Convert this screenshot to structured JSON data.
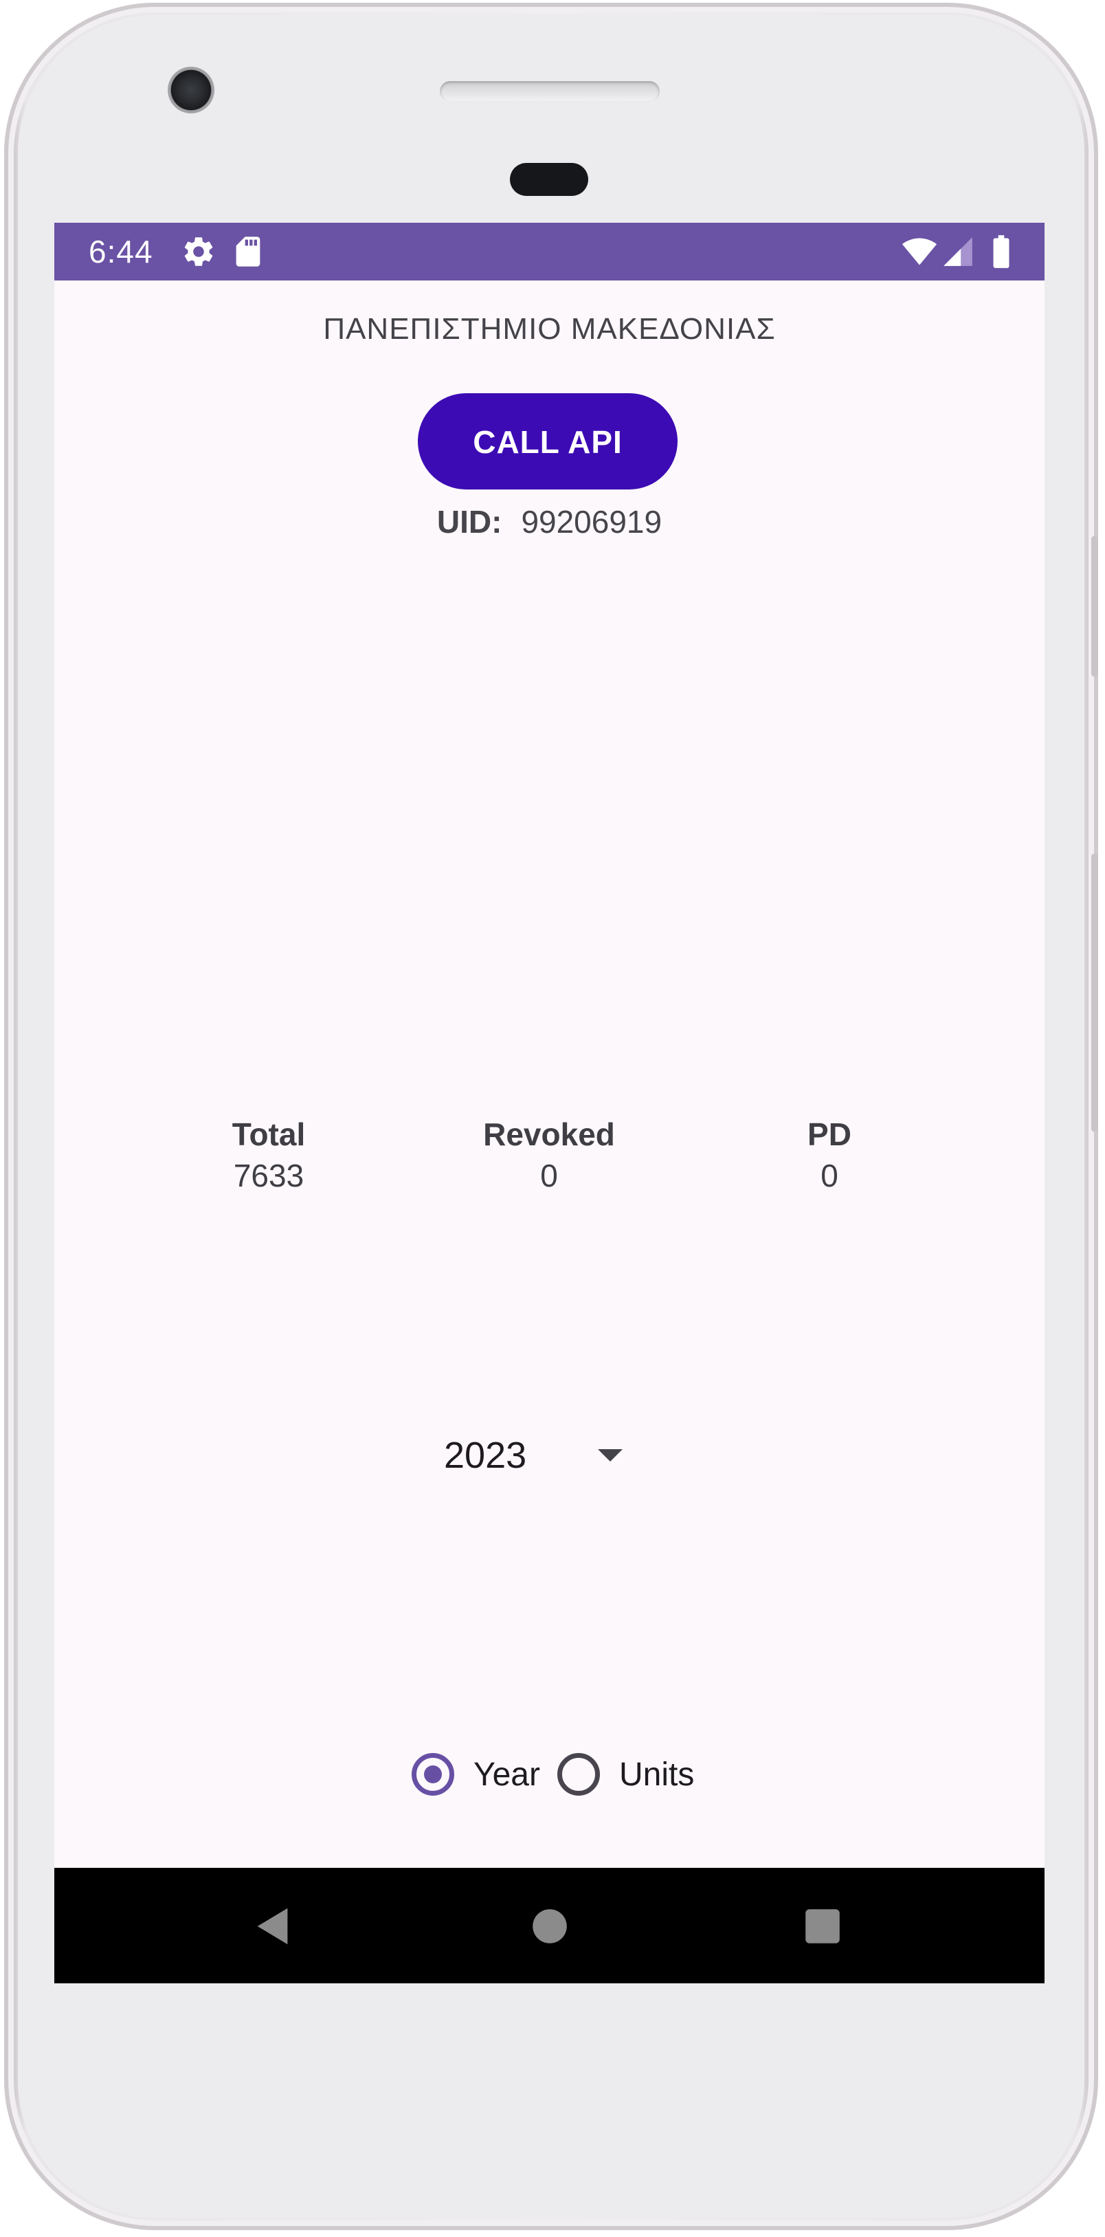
{
  "status_bar": {
    "time": "6:44",
    "icons": [
      "settings-icon",
      "sd-card-icon",
      "wifi-icon",
      "signal-icon",
      "battery-icon"
    ],
    "color": "#6a52a5"
  },
  "app": {
    "title": "ΠΑΝΕΠΙΣΤΗΜΙΟ ΜΑΚΕΔΟΝΙΑΣ",
    "call_button_label": "CALL API",
    "call_button_color": "#3d0bb4",
    "uid_label": "UID:",
    "uid_value": "99206919"
  },
  "stats": {
    "total_label": "Total",
    "total_value": "7633",
    "revoked_label": "Revoked",
    "revoked_value": "0",
    "pd_label": "PD",
    "pd_value": "0"
  },
  "year_select": {
    "selected": "2023",
    "icon": "dropdown-arrow-icon"
  },
  "radio_group": {
    "options": [
      {
        "label": "Year",
        "checked": true
      },
      {
        "label": "Units",
        "checked": false
      }
    ],
    "accent_color": "#6750a4"
  },
  "nav_bar": {
    "buttons": [
      "back-icon",
      "home-icon",
      "recents-icon"
    ]
  }
}
